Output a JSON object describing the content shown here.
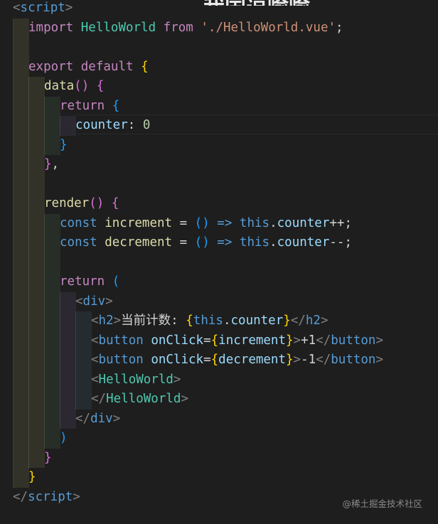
{
  "title_overlay": "我国逗喻喻",
  "watermark": "@稀土掘金技术社区",
  "colors": {
    "background": "#1e1e1e",
    "tag": "#808080",
    "tagname": "#569cd6",
    "keyword": "#c586c0",
    "variable": "#9cdcfe",
    "string": "#ce9178",
    "function": "#dcdcaa",
    "component": "#4ec9b0",
    "bracket_gold": "#ffd700",
    "bracket_pink": "#da70d6",
    "bracket_blue": "#179fff"
  },
  "code_lines": [
    {
      "indent": 0,
      "tokens": [
        [
          "tag",
          "<"
        ],
        [
          "tagname",
          "script"
        ],
        [
          "tag",
          ">"
        ]
      ]
    },
    {
      "indent": 1,
      "tokens": [
        [
          "kw",
          "import"
        ],
        [
          "plain",
          " "
        ],
        [
          "comp",
          "HelloWorld"
        ],
        [
          "plain",
          " "
        ],
        [
          "kw",
          "from"
        ],
        [
          "plain",
          " "
        ],
        [
          "str",
          "'./HelloWorld.vue'"
        ],
        [
          "plain",
          ";"
        ]
      ]
    },
    {
      "indent": 1,
      "tokens": []
    },
    {
      "indent": 1,
      "tokens": [
        [
          "kw",
          "export"
        ],
        [
          "plain",
          " "
        ],
        [
          "kw",
          "default"
        ],
        [
          "plain",
          " "
        ],
        [
          "b1",
          "{"
        ]
      ]
    },
    {
      "indent": 2,
      "tokens": [
        [
          "fn",
          "data"
        ],
        [
          "b2",
          "()"
        ],
        [
          "plain",
          " "
        ],
        [
          "b2",
          "{"
        ]
      ]
    },
    {
      "indent": 3,
      "tokens": [
        [
          "kw",
          "return"
        ],
        [
          "plain",
          " "
        ],
        [
          "b3",
          "{"
        ]
      ]
    },
    {
      "indent": 4,
      "tokens": [
        [
          "var",
          "counter"
        ],
        [
          "plain",
          ": "
        ],
        [
          "num",
          "0"
        ]
      ]
    },
    {
      "indent": 3,
      "tokens": [
        [
          "b3",
          "}"
        ]
      ]
    },
    {
      "indent": 2,
      "tokens": [
        [
          "b2",
          "}"
        ],
        [
          "plain",
          ","
        ]
      ]
    },
    {
      "indent": 2,
      "tokens": []
    },
    {
      "indent": 2,
      "tokens": [
        [
          "fn",
          "render"
        ],
        [
          "b2",
          "()"
        ],
        [
          "plain",
          " "
        ],
        [
          "b2",
          "{"
        ]
      ]
    },
    {
      "indent": 3,
      "tokens": [
        [
          "storage",
          "const"
        ],
        [
          "plain",
          " "
        ],
        [
          "fn",
          "increment"
        ],
        [
          "plain",
          " = "
        ],
        [
          "b3",
          "()"
        ],
        [
          "plain",
          " "
        ],
        [
          "storage",
          "=>"
        ],
        [
          "plain",
          " "
        ],
        [
          "storage",
          "this"
        ],
        [
          "plain",
          "."
        ],
        [
          "var",
          "counter"
        ],
        [
          "plain",
          "++;"
        ]
      ]
    },
    {
      "indent": 3,
      "tokens": [
        [
          "storage",
          "const"
        ],
        [
          "plain",
          " "
        ],
        [
          "fn",
          "decrement"
        ],
        [
          "plain",
          " = "
        ],
        [
          "b3",
          "()"
        ],
        [
          "plain",
          " "
        ],
        [
          "storage",
          "=>"
        ],
        [
          "plain",
          " "
        ],
        [
          "storage",
          "this"
        ],
        [
          "plain",
          "."
        ],
        [
          "var",
          "counter"
        ],
        [
          "plain",
          "--;"
        ]
      ]
    },
    {
      "indent": 3,
      "tokens": []
    },
    {
      "indent": 3,
      "tokens": [
        [
          "kw",
          "return"
        ],
        [
          "plain",
          " "
        ],
        [
          "b3",
          "("
        ]
      ]
    },
    {
      "indent": 4,
      "tokens": [
        [
          "tag",
          "<"
        ],
        [
          "tagname",
          "div"
        ],
        [
          "tag",
          ">"
        ]
      ]
    },
    {
      "indent": 5,
      "tokens": [
        [
          "tag",
          "<"
        ],
        [
          "tagname",
          "h2"
        ],
        [
          "tag",
          ">"
        ],
        [
          "plain",
          "当前计数: "
        ],
        [
          "b1",
          "{"
        ],
        [
          "storage",
          "this"
        ],
        [
          "plain",
          "."
        ],
        [
          "var",
          "counter"
        ],
        [
          "b1",
          "}"
        ],
        [
          "tag",
          "</"
        ],
        [
          "tagname",
          "h2"
        ],
        [
          "tag",
          ">"
        ]
      ]
    },
    {
      "indent": 5,
      "tokens": [
        [
          "tag",
          "<"
        ],
        [
          "tagname",
          "button"
        ],
        [
          "plain",
          " "
        ],
        [
          "var",
          "onClick"
        ],
        [
          "plain",
          "="
        ],
        [
          "b1",
          "{"
        ],
        [
          "var",
          "increment"
        ],
        [
          "b1",
          "}"
        ],
        [
          "tag",
          ">"
        ],
        [
          "plain",
          "+1"
        ],
        [
          "tag",
          "</"
        ],
        [
          "tagname",
          "button"
        ],
        [
          "tag",
          ">"
        ]
      ]
    },
    {
      "indent": 5,
      "tokens": [
        [
          "tag",
          "<"
        ],
        [
          "tagname",
          "button"
        ],
        [
          "plain",
          " "
        ],
        [
          "var",
          "onClick"
        ],
        [
          "plain",
          "="
        ],
        [
          "b1",
          "{"
        ],
        [
          "var",
          "decrement"
        ],
        [
          "b1",
          "}"
        ],
        [
          "tag",
          ">"
        ],
        [
          "plain",
          "-1"
        ],
        [
          "tag",
          "</"
        ],
        [
          "tagname",
          "button"
        ],
        [
          "tag",
          ">"
        ]
      ]
    },
    {
      "indent": 5,
      "tokens": [
        [
          "tag",
          "<"
        ],
        [
          "comp",
          "HelloWorld"
        ],
        [
          "tag",
          ">"
        ]
      ]
    },
    {
      "indent": 5,
      "tokens": [
        [
          "tag",
          "</"
        ],
        [
          "comp",
          "HelloWorld"
        ],
        [
          "tag",
          ">"
        ]
      ]
    },
    {
      "indent": 4,
      "tokens": [
        [
          "tag",
          "</"
        ],
        [
          "tagname",
          "div"
        ],
        [
          "tag",
          ">"
        ]
      ]
    },
    {
      "indent": 3,
      "tokens": [
        [
          "b3",
          ")"
        ]
      ]
    },
    {
      "indent": 2,
      "tokens": [
        [
          "b2",
          "}"
        ]
      ]
    },
    {
      "indent": 1,
      "tokens": [
        [
          "b1",
          "}"
        ]
      ]
    },
    {
      "indent": 0,
      "tokens": [
        [
          "tag",
          "</"
        ],
        [
          "tagname",
          "script"
        ],
        [
          "tag",
          ">"
        ]
      ]
    }
  ]
}
